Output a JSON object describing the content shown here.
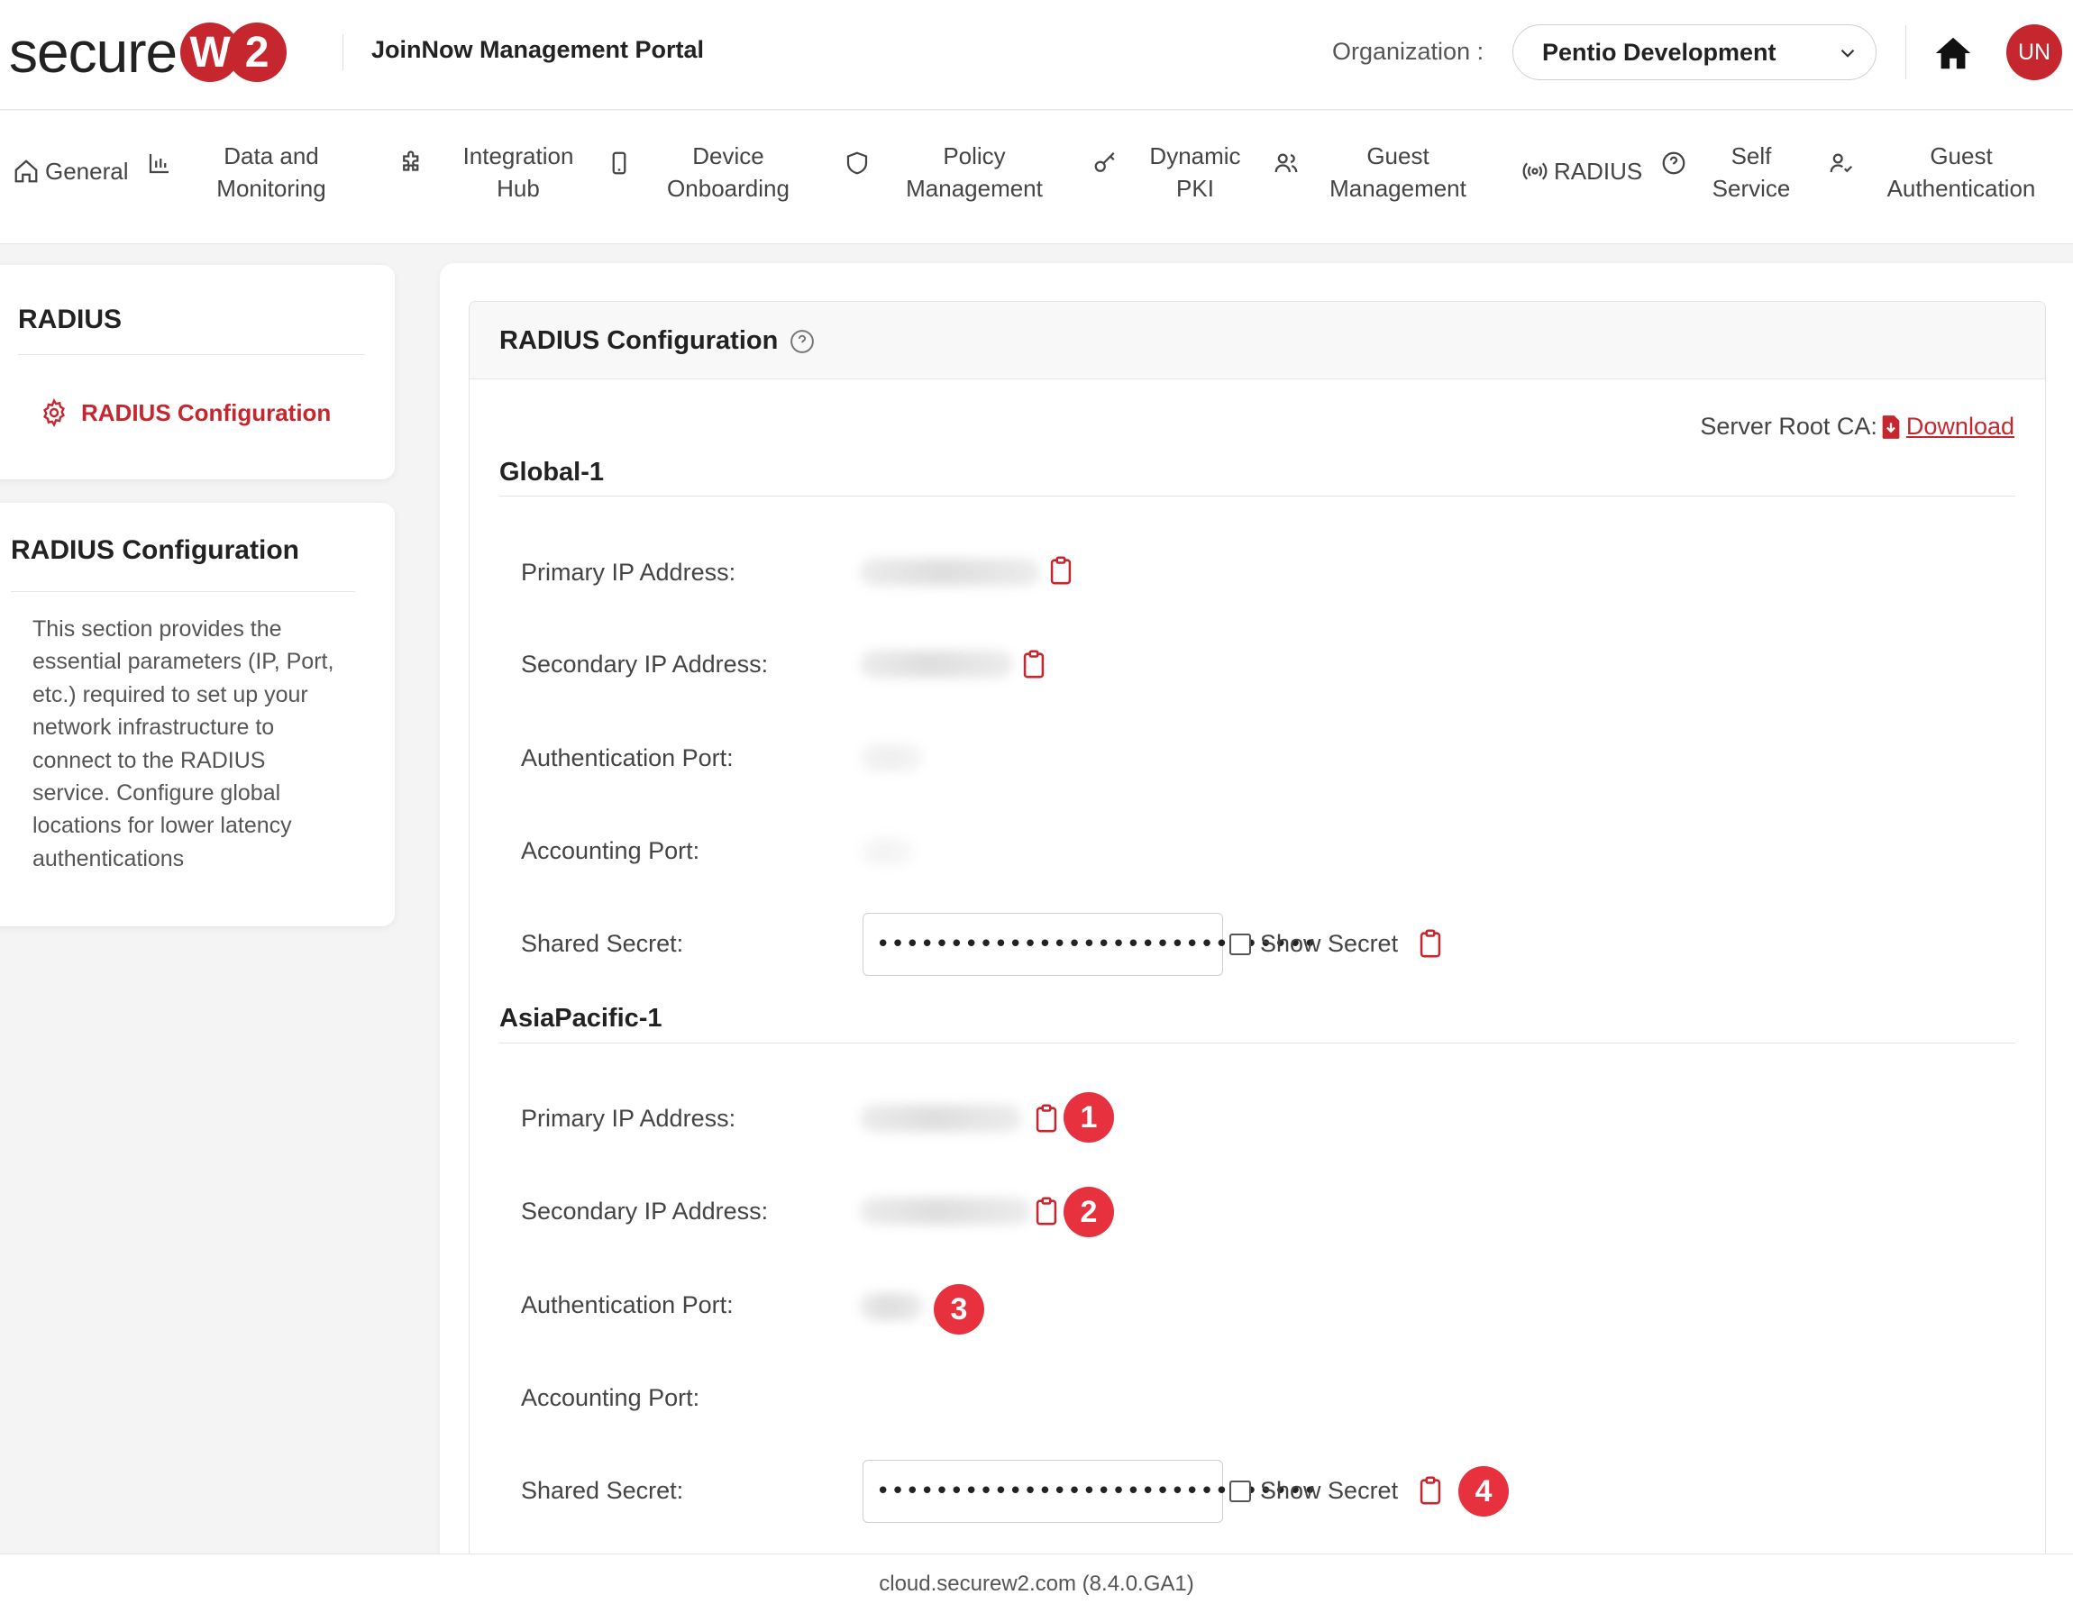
{
  "header": {
    "logo_text": "secure",
    "logo_w": "W",
    "logo_2": "2",
    "portal_title": "JoinNow Management Portal",
    "org_label": "Organization :",
    "org_value": "Pentio Development",
    "avatar_initials": "UN"
  },
  "nav": {
    "items": [
      {
        "label_1": "General",
        "label_2": "",
        "icon": "home-icon"
      },
      {
        "label_1": "Data and",
        "label_2": "Monitoring",
        "icon": "bar-chart-icon"
      },
      {
        "label_1": "Integration",
        "label_2": "Hub",
        "icon": "puzzle-icon"
      },
      {
        "label_1": "Device",
        "label_2": "Onboarding",
        "icon": "phone-icon"
      },
      {
        "label_1": "Policy",
        "label_2": "Management",
        "icon": "shield-icon"
      },
      {
        "label_1": "Dynamic",
        "label_2": "PKI",
        "icon": "key-icon"
      },
      {
        "label_1": "Guest",
        "label_2": "Management",
        "icon": "users-icon"
      },
      {
        "label_1": "RADIUS",
        "label_2": "",
        "icon": "broadcast-icon"
      },
      {
        "label_1": "Self",
        "label_2": "Service",
        "icon": "help-circle-icon"
      },
      {
        "label_1": "Guest",
        "label_2": "Authentication",
        "icon": "user-check-icon"
      }
    ]
  },
  "sidebar": {
    "title": "RADIUS",
    "link_label": "RADIUS Configuration",
    "info_title": "RADIUS Configuration",
    "info_lines": [
      "This section provides the",
      "essential parameters (IP, Port,",
      "etc.) required to set up your",
      "network infrastructure to",
      "connect to the RADIUS",
      "service. Configure global",
      "locations for lower latency",
      "authentications"
    ]
  },
  "main": {
    "title": "RADIUS Configuration",
    "root_ca_label": "Server Root CA:",
    "download_label": "Download",
    "sections": [
      {
        "name": "Global-1",
        "primary_ip_label": "Primary IP Address:",
        "secondary_ip_label": "Secondary IP Address:",
        "auth_port_label": "Authentication Port:",
        "acct_port_label": "Accounting Port:",
        "shared_secret_label": "Shared Secret:",
        "shared_secret_value": "••••••••••••••••••••••••••••••",
        "show_secret_label": "Show Secret"
      },
      {
        "name": "AsiaPacific-1",
        "primary_ip_label": "Primary IP Address:",
        "secondary_ip_label": "Secondary IP Address:",
        "auth_port_label": "Authentication Port:",
        "acct_port_label": "Accounting Port:",
        "shared_secret_label": "Shared Secret:",
        "shared_secret_value": "••••••••••••••••••••••••••••••",
        "show_secret_label": "Show Secret"
      }
    ],
    "badges": [
      "1",
      "2",
      "3",
      "4"
    ]
  },
  "footer": {
    "text": "cloud.securew2.com (8.4.0.GA1)"
  },
  "colors": {
    "brand_red": "#c6262e",
    "badge_red": "#e8313f"
  }
}
